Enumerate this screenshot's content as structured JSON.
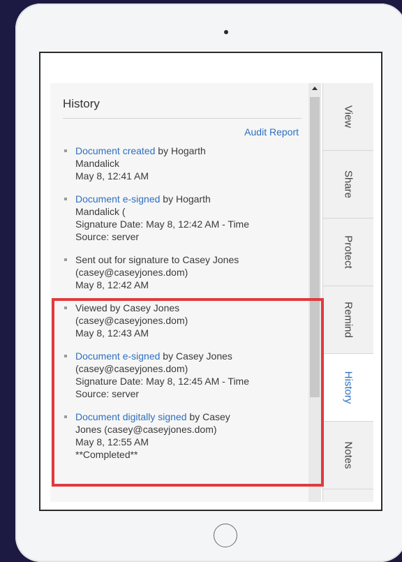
{
  "panel": {
    "title": "History",
    "audit_report": "Audit Report"
  },
  "history": [
    {
      "link": "Document created",
      "lines": [
        " by Hogarth",
        "Mandalick",
        "May 8, 12:41 AM"
      ]
    },
    {
      "link": "Document e-signed",
      "lines": [
        " by Hogarth",
        "Mandalick (",
        "Signature Date: May 8, 12:42 AM - Time",
        "Source: server"
      ]
    },
    {
      "link": "",
      "lines": [
        "Sent out for signature to Casey Jones",
        "(casey@caseyjones.dom)",
        "May 8, 12:42 AM"
      ]
    },
    {
      "link": "",
      "lines": [
        "Viewed by Casey Jones",
        "(casey@caseyjones.dom)",
        "May 8, 12:43 AM"
      ]
    },
    {
      "link": "Document e-signed",
      "lines": [
        " by Casey Jones",
        "(casey@caseyjones.dom)",
        "Signature Date: May 8, 12:45 AM - Time",
        "Source: server"
      ]
    },
    {
      "link": "Document digitally signed",
      "lines": [
        " by Casey",
        "Jones (casey@caseyjones.dom)",
        "May 8, 12:55 AM",
        "**Completed**"
      ]
    }
  ],
  "tabs": [
    {
      "label": "View",
      "active": false
    },
    {
      "label": "Share",
      "active": false
    },
    {
      "label": "Protect",
      "active": false
    },
    {
      "label": "Remind",
      "active": false
    },
    {
      "label": "History",
      "active": true
    },
    {
      "label": "Notes",
      "active": false
    }
  ],
  "icons": {
    "scroll_up": "triangle-up-icon",
    "home": "home-button-icon",
    "camera": "camera-icon"
  },
  "colors": {
    "link": "#2d6fc1",
    "highlight": "#e03a3e",
    "background": "#1c1a43"
  }
}
